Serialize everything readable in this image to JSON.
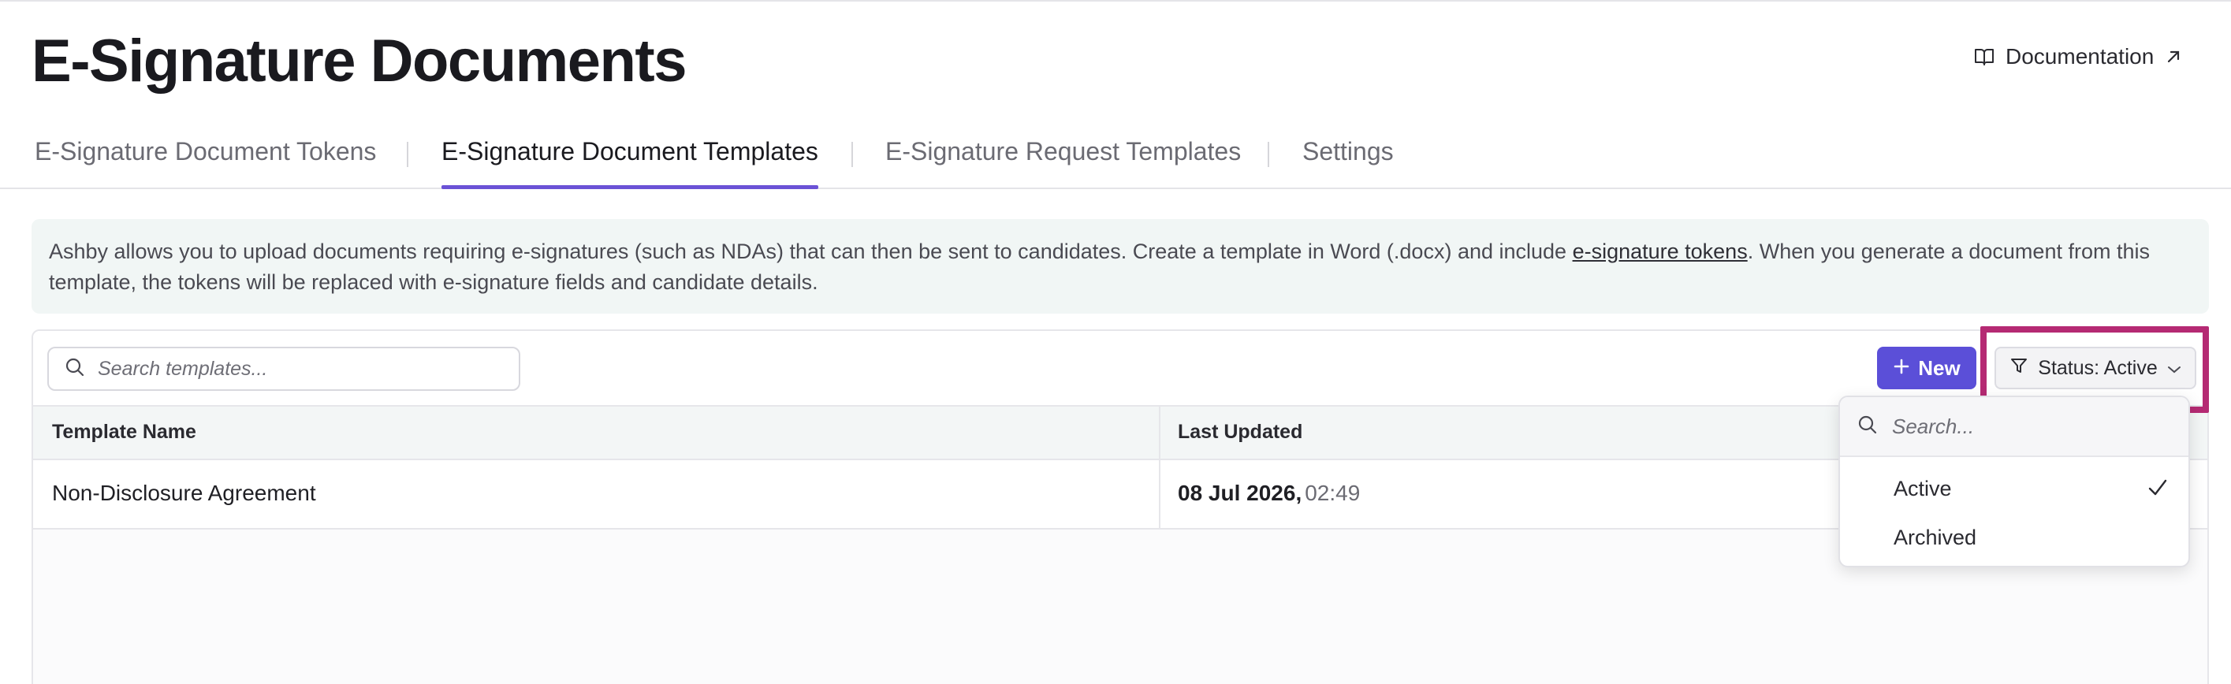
{
  "page": {
    "title": "E-Signature Documents",
    "documentation_label": "Documentation"
  },
  "tabs": [
    {
      "label": "E-Signature Document Tokens",
      "active": false
    },
    {
      "label": "E-Signature Document Templates",
      "active": true
    },
    {
      "label": "E-Signature Request Templates",
      "active": false
    },
    {
      "label": "Settings",
      "active": false
    }
  ],
  "banner": {
    "text_before": "Ashby allows you to upload documents requiring e-signatures (such as NDAs) that can then be sent to candidates. Create a template in Word (.docx) and include ",
    "link_text": "e-signature tokens",
    "text_after": ". When you generate a document from this template, the tokens will be replaced with e-signature fields and candidate details."
  },
  "toolbar": {
    "search_placeholder": "Search templates...",
    "new_label": "New",
    "status_label": "Status: Active"
  },
  "table": {
    "columns": [
      "Template Name",
      "Last Updated"
    ],
    "rows": [
      {
        "name": "Non-Disclosure Agreement",
        "date": "08 Jul 2026,",
        "time": "02:49"
      }
    ]
  },
  "status_dropdown": {
    "search_placeholder": "Search...",
    "options": [
      {
        "label": "Active",
        "selected": true
      },
      {
        "label": "Archived",
        "selected": false
      }
    ]
  },
  "colors": {
    "accent": "#5b4fd8",
    "tab_underline": "#6b52d6",
    "highlight": "#b52a73",
    "banner_bg": "#f1f6f5"
  }
}
